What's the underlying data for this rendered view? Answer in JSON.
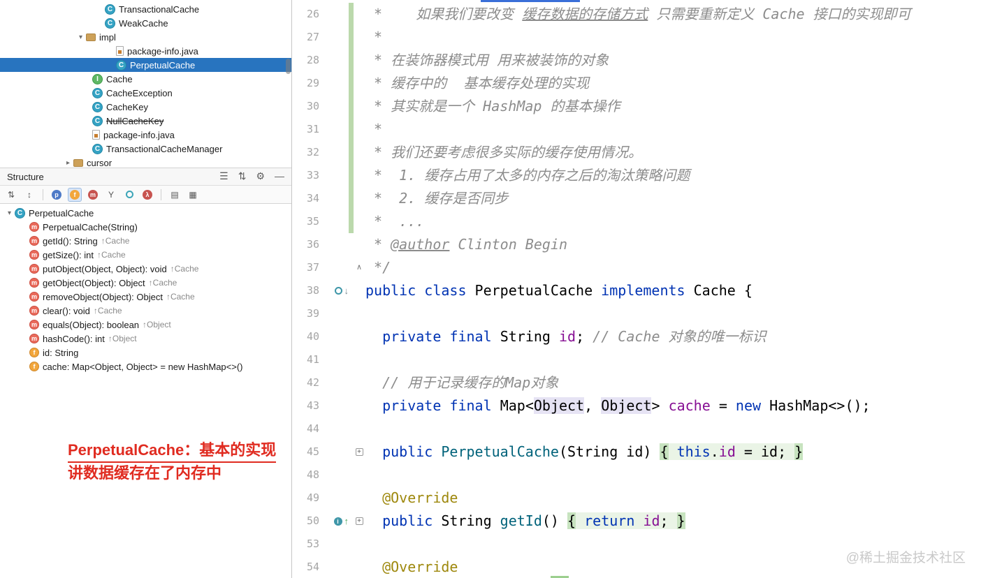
{
  "colors": {
    "selection_blue": "#2874BF",
    "keyword_blue": "#0033B3",
    "comment_gray": "#8C8C8C",
    "field_purple": "#871094",
    "method_teal": "#00627A",
    "annotation_olive": "#9E880D",
    "change_marker_green": "#BBD9AC",
    "fold_background": "#EAF4E6",
    "tab_indicator_blue": "#3A6FD8",
    "annotation_red": "#E02B20"
  },
  "project_tree": {
    "items": [
      {
        "pad": 150,
        "icon": "class",
        "label": "TransactionalCache"
      },
      {
        "pad": 150,
        "icon": "class",
        "label": "WeakCache"
      },
      {
        "pad": 108,
        "chevron": "down",
        "icon": "package",
        "label": "impl"
      },
      {
        "pad": 166,
        "icon": "javafile",
        "label": "package-info.java"
      },
      {
        "pad": 166,
        "icon": "class",
        "label": "PerpetualCache",
        "selected": true
      },
      {
        "pad": 132,
        "icon": "interface",
        "label": "Cache"
      },
      {
        "pad": 132,
        "icon": "class",
        "label": "CacheException"
      },
      {
        "pad": 132,
        "icon": "class",
        "label": "CacheKey"
      },
      {
        "pad": 132,
        "icon": "class",
        "label": "NullCacheKey",
        "strike": true
      },
      {
        "pad": 132,
        "icon": "javafile",
        "label": "package-info.java"
      },
      {
        "pad": 132,
        "icon": "class",
        "label": "TransactionalCacheManager"
      },
      {
        "pad": 90,
        "chevron": "right",
        "icon": "package",
        "label": "cursor"
      }
    ]
  },
  "structure_panel": {
    "title": "Structure",
    "header_icons": [
      {
        "name": "view-options-icon",
        "glyph": "☰"
      },
      {
        "name": "sort-icon",
        "glyph": "⇅"
      },
      {
        "name": "settings-gear-icon",
        "glyph": "⚙"
      },
      {
        "name": "hide-icon",
        "glyph": "—"
      }
    ],
    "toolbar": [
      {
        "name": "sort-alphabetically-icon",
        "glyph": "⇅"
      },
      {
        "name": "sort-by-visibility-icon",
        "glyph": "↕"
      },
      {
        "sep": true
      },
      {
        "name": "show-properties-icon",
        "glyph": "p",
        "shape": "circle",
        "bg": "#4E7AC7"
      },
      {
        "name": "show-fields-icon",
        "glyph": "f",
        "shape": "circle",
        "bg": "#F2A63C",
        "selected": true
      },
      {
        "name": "show-non-public-icon",
        "glyph": "m",
        "shape": "circle",
        "bg": "#C75450"
      },
      {
        "name": "filter-icon",
        "glyph": "Y"
      },
      {
        "name": "show-inherited-icon",
        "glyph": "",
        "shape": "ring"
      },
      {
        "name": "show-lambdas-icon",
        "glyph": "λ",
        "shape": "circle",
        "bg": "#C75450"
      },
      {
        "sep": true
      },
      {
        "name": "group-methods-icon",
        "glyph": "▤"
      },
      {
        "name": "group-by-type-icon",
        "glyph": "▦"
      }
    ],
    "items": [
      {
        "pad": 6,
        "chevron": "down",
        "icon": "class",
        "label": "PerpetualCache"
      },
      {
        "pad": 42,
        "icon": "method",
        "label": "PerpetualCache(String)"
      },
      {
        "pad": 42,
        "icon": "method",
        "label": "getId(): String",
        "suffix": "↑Cache"
      },
      {
        "pad": 42,
        "icon": "method",
        "label": "getSize(): int",
        "suffix": "↑Cache"
      },
      {
        "pad": 42,
        "icon": "method",
        "label": "putObject(Object, Object): void",
        "suffix": "↑Cache"
      },
      {
        "pad": 42,
        "icon": "method",
        "label": "getObject(Object): Object",
        "suffix": "↑Cache"
      },
      {
        "pad": 42,
        "icon": "method",
        "label": "removeObject(Object): Object",
        "suffix": "↑Cache"
      },
      {
        "pad": 42,
        "icon": "method",
        "label": "clear(): void",
        "suffix": "↑Cache"
      },
      {
        "pad": 42,
        "icon": "method",
        "label": "equals(Object): boolean",
        "suffix": "↑Object"
      },
      {
        "pad": 42,
        "icon": "method",
        "label": "hashCode(): int",
        "suffix": "↑Object"
      },
      {
        "pad": 42,
        "icon": "field",
        "label": "id: String"
      },
      {
        "pad": 42,
        "icon": "field",
        "label": "cache: Map<Object, Object> = new HashMap<>()"
      }
    ]
  },
  "annotation": {
    "line1": "PerpetualCache：基本的实现",
    "line2": "讲数据缓存在了内存中"
  },
  "watermark": {
    "text": "@稀土掘金技术社区"
  },
  "editor": {
    "lines": [
      {
        "num": "26",
        "bar": true,
        "tokens": [
          {
            "t": " *    如果我们要改变 ",
            "s": "cm"
          },
          {
            "t": "缓存数据的存储方式",
            "s": "cm",
            "u": true
          },
          {
            "t": " 只需要重新定义 Cache 接口的实现即可",
            "s": "cm"
          }
        ]
      },
      {
        "num": "27",
        "bar": true,
        "tokens": [
          {
            "t": " *",
            "s": "cm"
          }
        ]
      },
      {
        "num": "28",
        "bar": true,
        "tokens": [
          {
            "t": " * 在装饰器模式用 用来被装饰的对象",
            "s": "cm"
          }
        ]
      },
      {
        "num": "29",
        "bar": true,
        "tokens": [
          {
            "t": " * 缓存中的  基本缓存处理的实现",
            "s": "cm"
          }
        ]
      },
      {
        "num": "30",
        "bar": true,
        "tokens": [
          {
            "t": " * 其实就是一个 HashMap 的基本操作",
            "s": "cm"
          }
        ]
      },
      {
        "num": "31",
        "bar": true,
        "tokens": [
          {
            "t": " *",
            "s": "cm"
          }
        ]
      },
      {
        "num": "32",
        "bar": true,
        "tokens": [
          {
            "t": " * 我们还要考虑很多实际的缓存使用情况。",
            "s": "cm"
          }
        ]
      },
      {
        "num": "33",
        "bar": true,
        "tokens": [
          {
            "t": " *  1. 缓存占用了太多的内存之后的淘汰策略问题",
            "s": "cm"
          }
        ]
      },
      {
        "num": "34",
        "bar": true,
        "tokens": [
          {
            "t": " *  2. 缓存是否同步",
            "s": "cm"
          }
        ]
      },
      {
        "num": "35",
        "bar": true,
        "tokens": [
          {
            "t": " *  ...",
            "s": "cm"
          }
        ]
      },
      {
        "num": "36",
        "tokens": [
          {
            "t": " * ",
            "s": "cm"
          },
          {
            "t": "@author",
            "s": "cm",
            "u": true
          },
          {
            "t": " Clinton Begin",
            "s": "cm"
          }
        ]
      },
      {
        "num": "37",
        "fold": "up",
        "tokens": [
          {
            "t": " */",
            "s": "cm"
          }
        ]
      },
      {
        "num": "38",
        "gicons": [
          "implemented"
        ],
        "tokens": [
          {
            "t": "public",
            "s": "kw"
          },
          {
            "t": " ",
            "s": "pl"
          },
          {
            "t": "class",
            "s": "kw"
          },
          {
            "t": " PerpetualCache ",
            "s": "pl"
          },
          {
            "t": "implements",
            "s": "kw"
          },
          {
            "t": " Cache {",
            "s": "pl"
          }
        ]
      },
      {
        "num": "39",
        "tokens": []
      },
      {
        "num": "40",
        "tokens": [
          {
            "t": "  ",
            "s": "pl"
          },
          {
            "t": "private",
            "s": "kw"
          },
          {
            "t": " ",
            "s": "pl"
          },
          {
            "t": "final",
            "s": "kw"
          },
          {
            "t": " String ",
            "s": "pl"
          },
          {
            "t": "id",
            "s": "fld"
          },
          {
            "t": "; ",
            "s": "pl"
          },
          {
            "t": "// Cache 对象的唯一标识",
            "s": "cm"
          }
        ]
      },
      {
        "num": "41",
        "tokens": []
      },
      {
        "num": "42",
        "tokens": [
          {
            "t": "  ",
            "s": "pl"
          },
          {
            "t": "// 用于记录缓存的Map对象",
            "s": "cm"
          }
        ]
      },
      {
        "num": "43",
        "tokens": [
          {
            "t": "  ",
            "s": "pl"
          },
          {
            "t": "private",
            "s": "kw"
          },
          {
            "t": " ",
            "s": "pl"
          },
          {
            "t": "final",
            "s": "kw"
          },
          {
            "t": " Map<",
            "s": "pl"
          },
          {
            "t": "Object",
            "s": "pl",
            "bg": "hl"
          },
          {
            "t": ", ",
            "s": "pl"
          },
          {
            "t": "Object",
            "s": "pl",
            "bg": "hl"
          },
          {
            "t": "> ",
            "s": "pl"
          },
          {
            "t": "cache",
            "s": "fld"
          },
          {
            "t": " = ",
            "s": "pl"
          },
          {
            "t": "new",
            "s": "kw"
          },
          {
            "t": " HashMap<>();",
            "s": "pl"
          }
        ]
      },
      {
        "num": "44",
        "tokens": []
      },
      {
        "num": "45",
        "fold": "plus",
        "tokens": [
          {
            "t": "  ",
            "s": "pl"
          },
          {
            "t": "public",
            "s": "kw"
          },
          {
            "t": " ",
            "s": "pl"
          },
          {
            "t": "PerpetualCache",
            "s": "mth"
          },
          {
            "t": "(String id) ",
            "s": "pl"
          },
          {
            "t": "{",
            "s": "pl",
            "bg": "fb"
          },
          {
            "t": " ",
            "s": "pl",
            "bg": "f"
          },
          {
            "t": "this",
            "s": "kw",
            "bg": "f"
          },
          {
            "t": ".",
            "s": "pl",
            "bg": "f"
          },
          {
            "t": "id",
            "s": "fld",
            "bg": "f"
          },
          {
            "t": " = id; ",
            "s": "pl",
            "bg": "f"
          },
          {
            "t": "}",
            "s": "pl",
            "bg": "fb"
          }
        ]
      },
      {
        "num": "48",
        "tokens": []
      },
      {
        "num": "49",
        "tokens": [
          {
            "t": "  ",
            "s": "pl"
          },
          {
            "t": "@Override",
            "s": "ann"
          }
        ]
      },
      {
        "num": "50",
        "fold": "plus",
        "gicons": [
          "overrides"
        ],
        "tokens": [
          {
            "t": "  ",
            "s": "pl"
          },
          {
            "t": "public",
            "s": "kw"
          },
          {
            "t": " String ",
            "s": "pl"
          },
          {
            "t": "getId",
            "s": "mth"
          },
          {
            "t": "() ",
            "s": "pl"
          },
          {
            "t": "{",
            "s": "pl",
            "bg": "fb"
          },
          {
            "t": " ",
            "s": "pl",
            "bg": "f"
          },
          {
            "t": "return",
            "s": "kw",
            "bg": "f"
          },
          {
            "t": " ",
            "s": "pl",
            "bg": "f"
          },
          {
            "t": "id",
            "s": "fld",
            "bg": "f"
          },
          {
            "t": "; ",
            "s": "pl",
            "bg": "f"
          },
          {
            "t": "}",
            "s": "pl",
            "bg": "fb"
          }
        ]
      },
      {
        "num": "53",
        "tokens": []
      },
      {
        "num": "54",
        "tokens": [
          {
            "t": "  ",
            "s": "pl"
          },
          {
            "t": "@Override",
            "s": "ann"
          }
        ]
      }
    ]
  }
}
